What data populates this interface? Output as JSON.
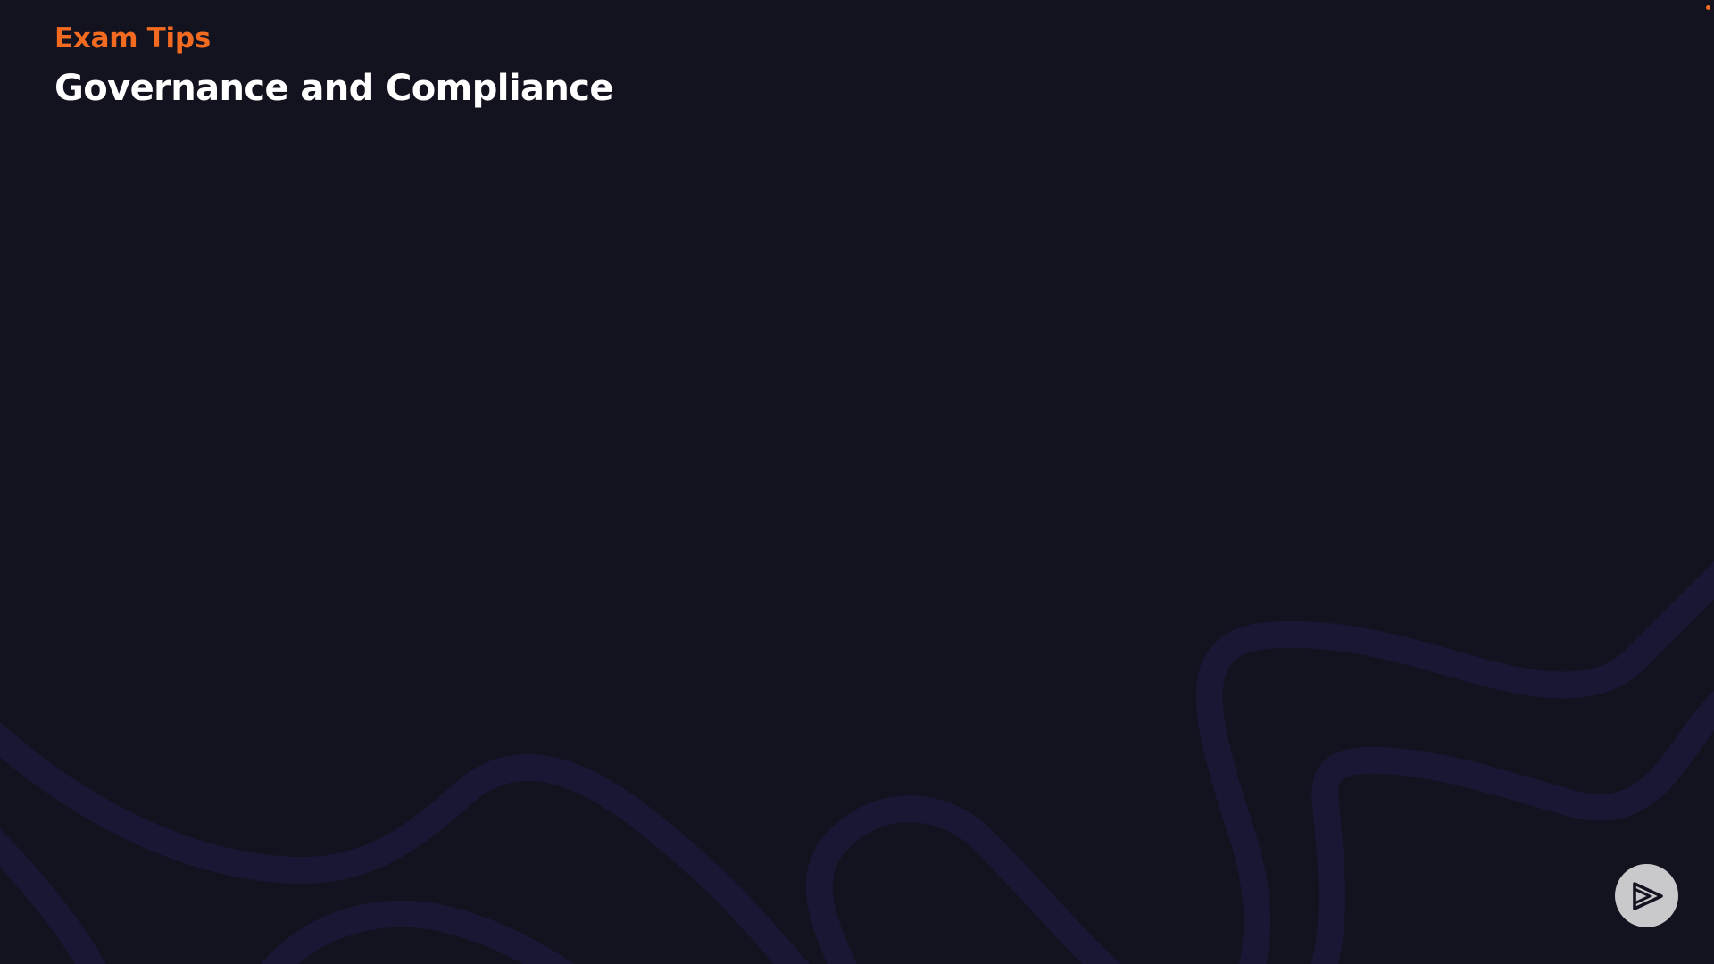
{
  "slide": {
    "eyebrow": "Exam Tips",
    "title": "Governance and Compliance"
  },
  "icons": {
    "logo": "play-logo-icon",
    "corner_indicator": "dot-icon"
  },
  "colors": {
    "background": "#13121f",
    "accent": "#f26b21",
    "title": "#ffffff",
    "wave": "#191734",
    "logo_bg": "#c9c9cc",
    "logo_fg": "#13121f"
  }
}
